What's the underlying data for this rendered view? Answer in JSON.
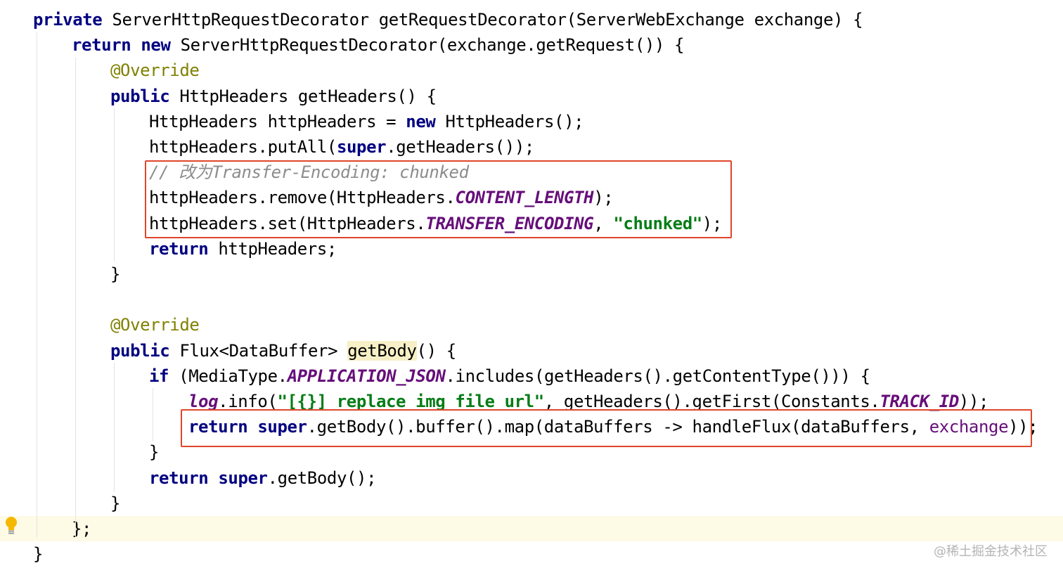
{
  "code_lines": [
    [
      {
        "t": "private",
        "c": "kw"
      },
      {
        "t": " ServerHttpRequestDecorator getRequestDecorator(ServerWebExchange exchange) {"
      }
    ],
    [
      {
        "t": "return",
        "c": "kw"
      },
      {
        "t": " "
      },
      {
        "t": "new",
        "c": "kw"
      },
      {
        "t": " ServerHttpRequestDecorator(exchange.getRequest()) {"
      }
    ],
    [
      {
        "t": "@Override",
        "c": "ann"
      }
    ],
    [
      {
        "t": "public",
        "c": "kw"
      },
      {
        "t": " HttpHeaders getHeaders() {"
      }
    ],
    [
      {
        "t": "HttpHeaders httpHeaders = "
      },
      {
        "t": "new",
        "c": "kw"
      },
      {
        "t": " HttpHeaders();"
      }
    ],
    [
      {
        "t": "httpHeaders.putAll("
      },
      {
        "t": "super",
        "c": "kw"
      },
      {
        "t": ".getHeaders());"
      }
    ],
    [
      {
        "t": "// 改为Transfer-Encoding: chunked",
        "c": "cmt"
      }
    ],
    [
      {
        "t": "httpHeaders.remove(HttpHeaders."
      },
      {
        "t": "CONTENT_LENGTH",
        "c": "cst"
      },
      {
        "t": ");"
      }
    ],
    [
      {
        "t": "httpHeaders.set(HttpHeaders."
      },
      {
        "t": "TRANSFER_ENCODING",
        "c": "cst"
      },
      {
        "t": ", "
      },
      {
        "t": "\"chunked\"",
        "c": "str"
      },
      {
        "t": ");"
      }
    ],
    [
      {
        "t": "return",
        "c": "kw"
      },
      {
        "t": " httpHeaders;"
      }
    ],
    [
      {
        "t": "}"
      }
    ],
    [],
    [
      {
        "t": "@Override",
        "c": "ann"
      }
    ],
    [
      {
        "t": "public",
        "c": "kw"
      },
      {
        "t": " Flux<DataBuffer> "
      },
      {
        "t": "getBody",
        "c": "hl"
      },
      {
        "t": "() {"
      }
    ],
    [
      {
        "t": "if",
        "c": "kw"
      },
      {
        "t": " (MediaType."
      },
      {
        "t": "APPLICATION_JSON",
        "c": "cst"
      },
      {
        "t": ".includes(getHeaders().getContentType())) {"
      }
    ],
    [
      {
        "t": "log",
        "c": "cst"
      },
      {
        "t": ".info("
      },
      {
        "t": "\"[{}] replace img file url\"",
        "c": "str"
      },
      {
        "t": ", getHeaders().getFirst(Constants."
      },
      {
        "t": "TRACK_ID",
        "c": "cst"
      },
      {
        "t": "));"
      }
    ],
    [
      {
        "t": "return",
        "c": "kw"
      },
      {
        "t": " "
      },
      {
        "t": "super",
        "c": "kw"
      },
      {
        "t": ".getBody().buffer().map(dataBuffers -> handleFlux(dataBuffers, "
      },
      {
        "t": "exchange",
        "c": "fld"
      },
      {
        "t": "));"
      }
    ],
    [
      {
        "t": "}"
      }
    ],
    [
      {
        "t": "return",
        "c": "kw"
      },
      {
        "t": " "
      },
      {
        "t": "super",
        "c": "kw"
      },
      {
        "t": ".getBody();"
      }
    ],
    [
      {
        "t": "}"
      }
    ],
    [
      {
        "t": "};"
      }
    ],
    [
      {
        "t": "}"
      }
    ]
  ],
  "watermark": "@稀土掘金技术社区",
  "colors": {
    "keyword": "#000080",
    "annotation": "#808000",
    "string": "#067d17",
    "comment": "#8c8c8c",
    "constant": "#660e7a",
    "highlight_box": "#e0452b",
    "current_line": "#fdfbe6"
  },
  "icons": {
    "gutter": "lightbulb-icon"
  }
}
